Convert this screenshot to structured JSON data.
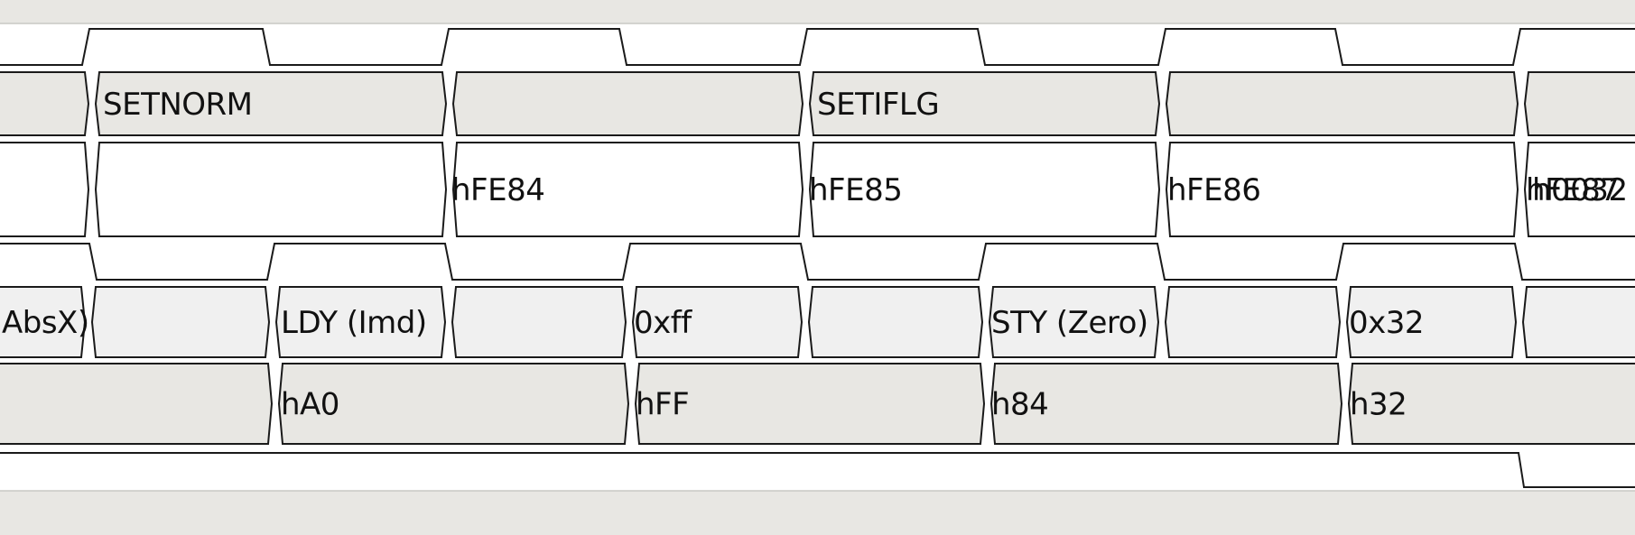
{
  "colors": {
    "background": "#e8e7e3",
    "lane_white": "#ffffff",
    "lane_gray": "#e8e7e3",
    "lane_light": "#f0f0f0",
    "stroke": "#1a1a1a",
    "grid": "#c8c8c4",
    "cursor": "#9a9a98"
  },
  "signals": [
    {
      "kind": "clock",
      "samples": [
        "low",
        "high",
        "low",
        "high",
        "low",
        "high",
        "low",
        "high",
        "low",
        "high"
      ]
    },
    {
      "kind": "bus",
      "fill": "gray",
      "segments": [
        {
          "label": ""
        },
        {
          "label": "SETNORM"
        },
        {
          "label": ""
        },
        {
          "label": "SETIFLG"
        },
        {
          "label": ""
        },
        {
          "label": ""
        }
      ]
    },
    {
      "kind": "bus",
      "fill": "white",
      "segments": [
        {
          "label": ""
        },
        {
          "label": "hFE84"
        },
        {
          "label": "hFE85"
        },
        {
          "label": "hFE86"
        },
        {
          "label": "hFE87"
        },
        {
          "label": "h0032"
        }
      ]
    },
    {
      "kind": "clock",
      "samples": [
        "high",
        "low",
        "high",
        "low",
        "high",
        "low",
        "high",
        "low",
        "high",
        "low"
      ]
    },
    {
      "kind": "bus",
      "fill": "light",
      "segments": [
        {
          "label": "AbsX)"
        },
        {
          "label": ""
        },
        {
          "label": "LDY (Imd)"
        },
        {
          "label": ""
        },
        {
          "label": "0xff"
        },
        {
          "label": ""
        },
        {
          "label": "STY (Zero)"
        },
        {
          "label": ""
        },
        {
          "label": "0x32"
        },
        {
          "label": ""
        }
      ]
    },
    {
      "kind": "bus",
      "fill": "gray",
      "segments": [
        {
          "label": ""
        },
        {
          "label": "hA0"
        },
        {
          "label": "hFF"
        },
        {
          "label": "h84"
        },
        {
          "label": "h32"
        }
      ]
    },
    {
      "kind": "logic",
      "samples": [
        "high",
        "low"
      ]
    }
  ]
}
